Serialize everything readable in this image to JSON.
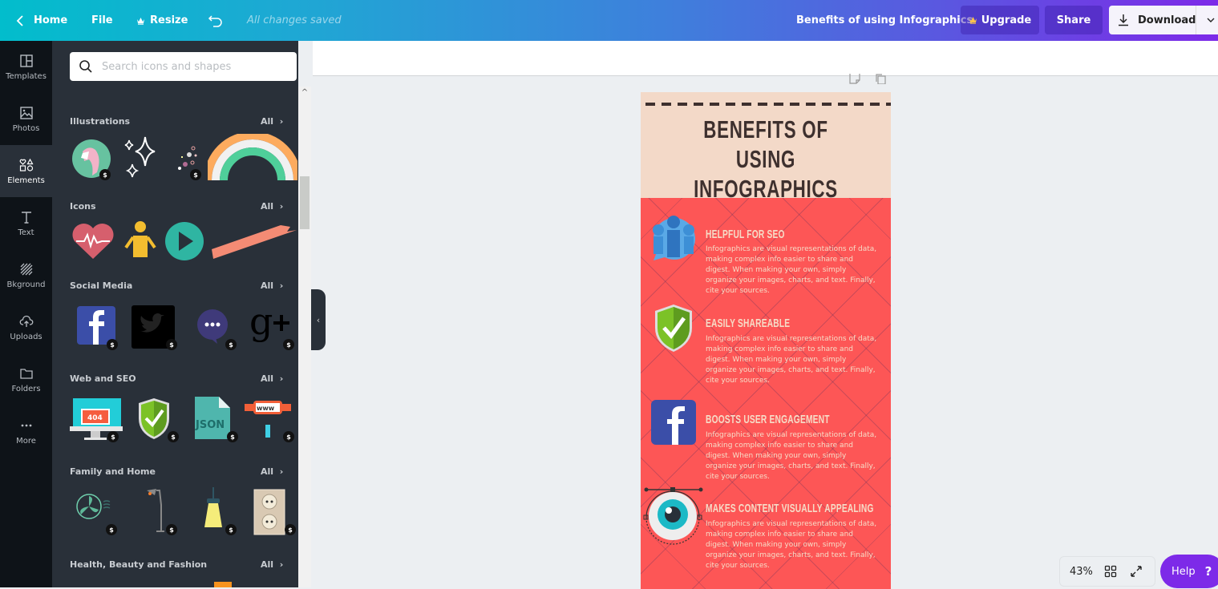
{
  "topbar": {
    "home_label": "Home",
    "file_label": "File",
    "resize_label": "Resize",
    "save_status": "All changes saved",
    "document_title": "Benefits of using Infographics",
    "upgrade_label": "Upgrade",
    "share_label": "Share",
    "download_label": "Download"
  },
  "rail": {
    "items": [
      {
        "label": "Templates",
        "icon": "templates-icon"
      },
      {
        "label": "Photos",
        "icon": "photos-icon"
      },
      {
        "label": "Elements",
        "icon": "elements-icon",
        "active": true
      },
      {
        "label": "Text",
        "icon": "text-icon"
      },
      {
        "label": "Bkground",
        "icon": "background-icon"
      },
      {
        "label": "Uploads",
        "icon": "uploads-icon"
      },
      {
        "label": "Folders",
        "icon": "folders-icon"
      },
      {
        "label": "More",
        "icon": "more-icon"
      }
    ]
  },
  "panel": {
    "search_placeholder": "Search icons and shapes",
    "all_label": "All",
    "paid_badge": "$",
    "sections": [
      {
        "title": "Illustrations",
        "items": [
          "unicorn",
          "sparkles",
          "confetti",
          "rainbow"
        ]
      },
      {
        "title": "Icons",
        "items": [
          "heart-pulse",
          "person",
          "play-button",
          "brush-stroke"
        ]
      },
      {
        "title": "Social Media",
        "items": [
          "facebook",
          "twitter",
          "chat-bubble",
          "google-plus"
        ]
      },
      {
        "title": "Web and SEO",
        "items": [
          "404-monitor",
          "shield-check",
          "json-file",
          "www-sign"
        ]
      },
      {
        "title": "Family and Home",
        "items": [
          "fan",
          "floor-lamp",
          "ceiling-lamp",
          "power-outlet"
        ]
      },
      {
        "title": "Health, Beauty and Fashion",
        "items": []
      }
    ]
  },
  "canvas": {
    "title": "BENEFITS OF USING INFOGRAPHICS",
    "title_line1": "BENEFITS OF USING",
    "title_line2": "INFOGRAPHICS",
    "benefits": [
      {
        "heading": "HELPFUL FOR SEO",
        "body": "Infographics are visual representations of data, making complex info easier to share and digest. When making your own, simply organize your images, charts, and text. Finally, cite your sources.",
        "icon": "people-chat-icon"
      },
      {
        "heading": "EASILY SHAREABLE",
        "body": "Infographics are visual representations of data, making complex info easier to share and digest. When making your own, simply organize your images, charts, and text. Finally, cite your sources.",
        "icon": "shield-check-icon"
      },
      {
        "heading": "BOOSTS USER ENGAGEMENT",
        "body": "Infographics are visual representations of data, making complex info easier to share and digest. When making your own, simply organize your images, charts, and text. Finally, cite your sources.",
        "icon": "facebook-icon"
      },
      {
        "heading": "MAKES CONTENT VISUALLY APPEALING",
        "body": "Infographics are visual representations of data, making complex info easier to share and digest. When making your own, simply organize your images, charts, and text. Finally, cite your sources.",
        "icon": "eye-icon"
      }
    ]
  },
  "footer": {
    "zoom_level": "43%",
    "help_label": "Help",
    "help_icon": "?"
  },
  "colors": {
    "accent": "#7d2ae8",
    "canvas_header": "#f3d9c8",
    "canvas_body": "#fd5656",
    "heading_text": "#3e302e"
  }
}
